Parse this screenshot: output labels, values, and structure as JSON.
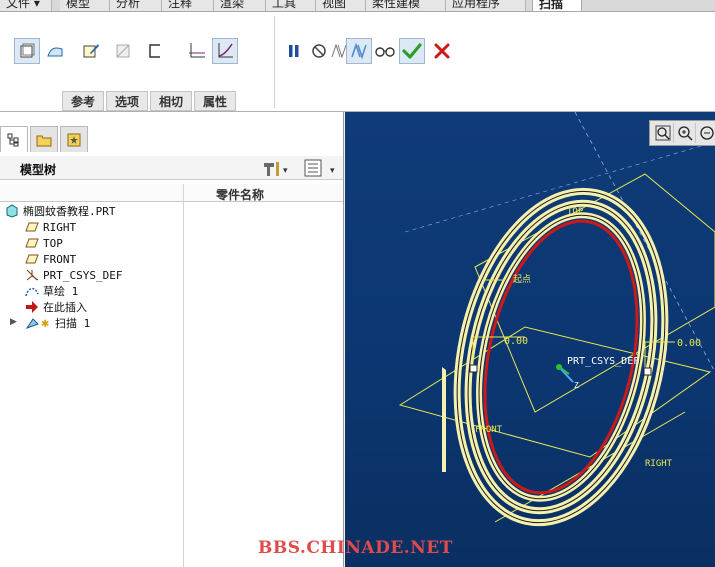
{
  "ribbon": {
    "tabs": [
      "文件",
      "模型",
      "分析",
      "注释",
      "渲染",
      "工具",
      "视图",
      "柔性建模",
      "应用程序",
      "扫描"
    ],
    "active_tab": "扫描",
    "subtabs": [
      "参考",
      "选项",
      "相切",
      "属性"
    ]
  },
  "icons": {
    "solid": "solid-extrude-icon",
    "surface": "surface-icon",
    "sketch": "sketch-icon",
    "remove": "remove-material-icon",
    "thicken": "thicken-icon",
    "constant": "constant-section-icon",
    "variable": "variable-section-icon",
    "pause": "pause-icon",
    "no_preview": "no-preview-icon",
    "preview": "preview-icon",
    "verify": "verify-icon",
    "glasses": "glasses-icon",
    "ok": "checkmark-icon",
    "cancel": "cancel-x-icon"
  },
  "tree": {
    "title": "模型树",
    "column": "零件名称",
    "items": [
      {
        "label": "椭圆蚊香教程.PRT",
        "icon": "part-icon"
      },
      {
        "label": "RIGHT",
        "icon": "datum-plane-icon"
      },
      {
        "label": "TOP",
        "icon": "datum-plane-icon"
      },
      {
        "label": "FRONT",
        "icon": "datum-plane-icon"
      },
      {
        "label": "PRT_CSYS_DEF",
        "icon": "coordinate-system-icon"
      },
      {
        "label": "草绘 1",
        "icon": "sketch-feature-icon"
      },
      {
        "label": "在此插入",
        "icon": "insert-here-arrow-icon"
      },
      {
        "label": "扫描 1",
        "icon": "sweep-feature-icon"
      }
    ]
  },
  "viewport": {
    "labels": {
      "top": "TOP",
      "csys": "PRT_CSYS_DEF",
      "dim_left": "0.00",
      "dim_right": "0.00",
      "front": "FRONT",
      "right": "RIGHT",
      "start": "起点",
      "axis": "Z"
    }
  },
  "watermark": "BBS.CHINADE.NET",
  "colors": {
    "viewport_bg": "#0f3b78",
    "spiral": "#f4f0b0",
    "trajectory": "#cc1a1a",
    "datum": "#e8e850",
    "check": "#2aa02a",
    "cancel": "#d01818"
  }
}
